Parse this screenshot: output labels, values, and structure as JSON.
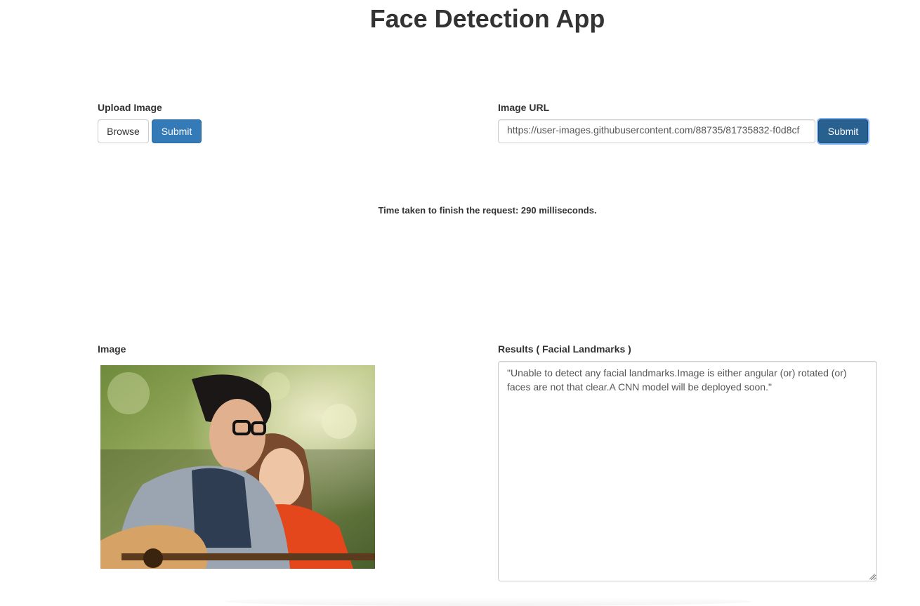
{
  "app": {
    "title": "Face Detection App"
  },
  "upload": {
    "label": "Upload Image",
    "browse_label": "Browse",
    "submit_label": "Submit"
  },
  "url_form": {
    "label": "Image URL",
    "value": "https://user-images.githubusercontent.com/88735/81735832-f0d8cf",
    "submit_label": "Submit"
  },
  "status": {
    "timing_text": "Time taken to finish the request: 290 milliseconds."
  },
  "image_panel": {
    "label": "Image",
    "alt": "Image"
  },
  "results_panel": {
    "label": "Results ( Facial Landmarks )",
    "text": "\"Unable to detect any facial landmarks.Image is either angular (or) rotated (or) faces are not that clear.A CNN model will be deployed soon.\""
  },
  "colors": {
    "primary": "#337ab7",
    "primary_focused": "#286090",
    "text": "#333333"
  }
}
